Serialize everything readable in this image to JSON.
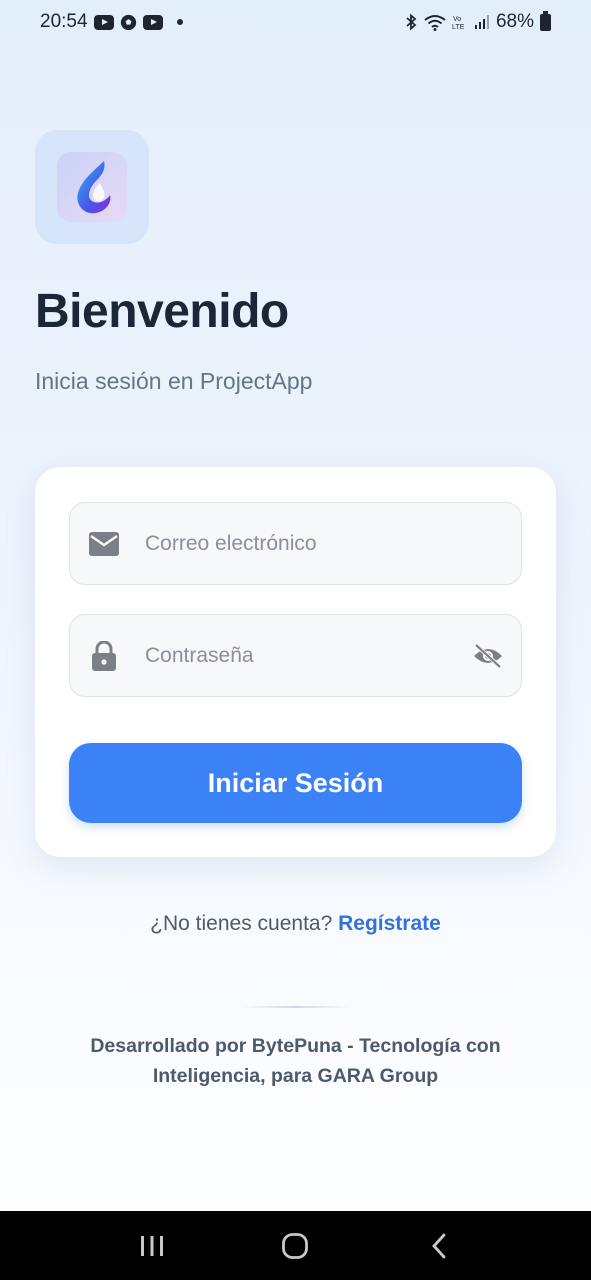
{
  "status_bar": {
    "time": "20:54",
    "battery": "68%",
    "icons": [
      "youtube-icon",
      "soccer-ball-icon",
      "youtube-icon",
      "notification-dot",
      "bluetooth-icon",
      "wifi-icon",
      "volte-icon",
      "signal-icon",
      "battery-icon"
    ]
  },
  "app": {
    "logo_icon": "flame-logo-icon",
    "title": "Bienvenido",
    "subtitle": "Inicia sesión en ProjectApp"
  },
  "form": {
    "email": {
      "icon": "mail-icon",
      "placeholder": "Correo electrónico",
      "value": ""
    },
    "password": {
      "icon": "lock-icon",
      "placeholder": "Contraseña",
      "value": "",
      "toggle_icon": "eye-off-icon"
    },
    "submit_label": "Iniciar Sesión"
  },
  "signup": {
    "prompt": "¿No tienes cuenta?",
    "link": "Regístrate"
  },
  "footer": {
    "line1": "Desarrollado por BytePuna - Tecnología con",
    "line2": "Inteligencia, para GARA Group"
  },
  "colors": {
    "primary": "#3b82f6",
    "link": "#3373d6",
    "title": "#1b2638",
    "muted": "#667487"
  },
  "nav_bar": {
    "buttons": [
      "recent-apps-icon",
      "home-icon",
      "back-icon"
    ]
  }
}
